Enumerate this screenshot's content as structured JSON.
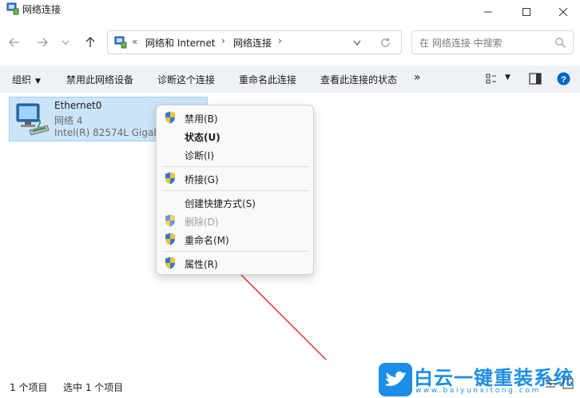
{
  "window": {
    "title": "网络连接",
    "minimize_icon": "minimize-icon",
    "maximize_icon": "maximize-icon",
    "close_icon": "close-icon"
  },
  "nav": {
    "breadcrumb_prefix": "«",
    "breadcrumb": [
      "网络和 Internet",
      "网络连接"
    ],
    "search_placeholder": "在 网络连接 中搜索"
  },
  "toolbar": {
    "organize": "组织",
    "disable_device": "禁用此网络设备",
    "diagnose": "诊断这个连接",
    "rename": "重命名此连接",
    "view_status": "查看此连接的状态",
    "more": "»"
  },
  "connection": {
    "name": "Ethernet0",
    "network": "网络 4",
    "adapter": "Intel(R) 82574L Gigab"
  },
  "context_menu": {
    "items": [
      {
        "label": "禁用(B)",
        "shield": true,
        "bold": false,
        "disabled": false
      },
      {
        "label": "状态(U)",
        "shield": false,
        "bold": true,
        "disabled": false
      },
      {
        "label": "诊断(I)",
        "shield": false,
        "bold": false,
        "disabled": false
      },
      {
        "label": "桥接(G)",
        "shield": true,
        "bold": false,
        "disabled": false
      },
      {
        "label": "创建快捷方式(S)",
        "shield": false,
        "bold": false,
        "disabled": false
      },
      {
        "label": "删除(D)",
        "shield": true,
        "bold": false,
        "disabled": true
      },
      {
        "label": "重命名(M)",
        "shield": true,
        "bold": false,
        "disabled": false
      },
      {
        "label": "属性(R)",
        "shield": true,
        "bold": false,
        "disabled": false
      }
    ]
  },
  "status": {
    "count": "1 个项目",
    "selected": "选中 1 个项目"
  },
  "watermark": {
    "brand": "白云一键重装系统",
    "url": "www.baiyunxitong.com"
  },
  "colors": {
    "accent": "#0067c0",
    "selection": "#cce4f7",
    "arrow": "#e2312f",
    "watermark_blue": "#1c8ee8"
  }
}
